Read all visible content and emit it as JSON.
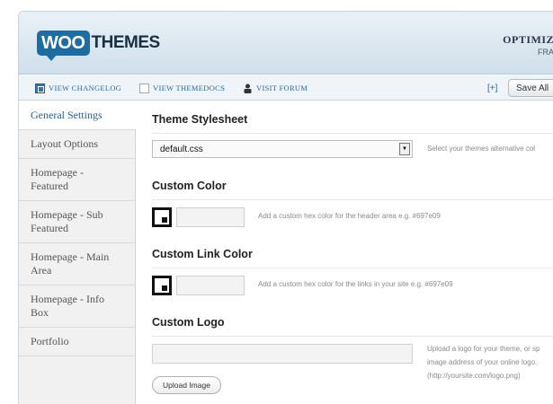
{
  "header": {
    "logo_woo": "WOO",
    "logo_themes": "THEMES",
    "title": "OPTIMIZ",
    "subtitle": "FRA"
  },
  "toolbar": {
    "links": [
      {
        "label": "View Changelog",
        "icon": "changelog-icon"
      },
      {
        "label": "View Themedocs",
        "icon": "document-icon"
      },
      {
        "label": "Visit Forum",
        "icon": "user-icon"
      }
    ],
    "expand_label": "[+]",
    "save_all_label": "Save All"
  },
  "sidebar": {
    "items": [
      {
        "label": "General Settings",
        "active": true
      },
      {
        "label": "Layout Options",
        "active": false
      },
      {
        "label": "Homepage - Featured",
        "active": false
      },
      {
        "label": "Homepage - Sub Featured",
        "active": false
      },
      {
        "label": "Homepage - Main Area",
        "active": false
      },
      {
        "label": "Homepage - Info Box",
        "active": false
      },
      {
        "label": "Portfolio",
        "active": false
      }
    ]
  },
  "main": {
    "stylesheet": {
      "title": "Theme Stylesheet",
      "value": "default.css",
      "help": "Select your themes alternative col"
    },
    "custom_color": {
      "title": "Custom Color",
      "value": "",
      "help": "Add a custom hex color for the header area e.g. #697e09"
    },
    "custom_link_color": {
      "title": "Custom Link Color",
      "value": "",
      "help": "Add a custom hex color for the links in your site e.g. #697e09"
    },
    "custom_logo": {
      "title": "Custom Logo",
      "value": "",
      "upload_label": "Upload Image",
      "help_lines": [
        "Upload a logo for your theme, or sp",
        "image address of your online logo.",
        "(http://yoursite.com/logo.png)"
      ]
    }
  },
  "colors": {
    "accent": "#22629a",
    "brand": "#1d6ca2"
  }
}
